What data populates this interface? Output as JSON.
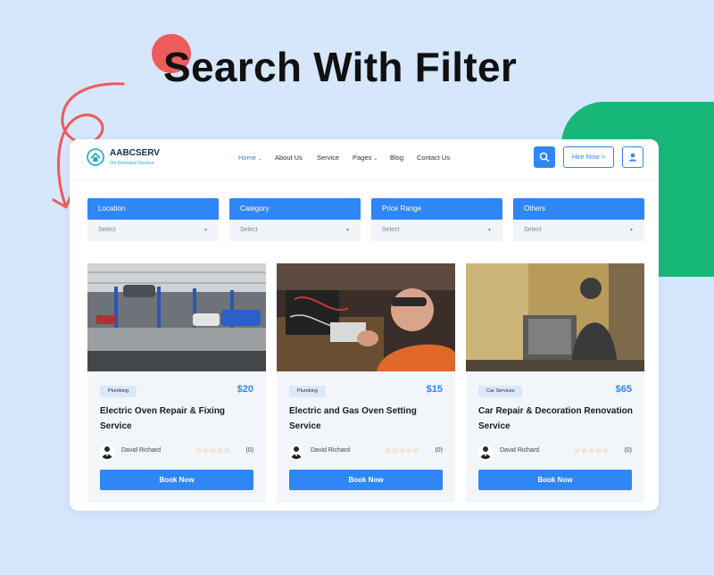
{
  "headline": "Search With Filter",
  "brand": {
    "name": "AABCSERV",
    "tagline": "On Demand Service"
  },
  "nav": {
    "items": [
      "Home",
      "About Us",
      "Service",
      "Pages",
      "Blog",
      "Contact Us"
    ],
    "active": "Home"
  },
  "actions": {
    "hire_label": "Hire Now >"
  },
  "filters": [
    {
      "label": "Location",
      "value": "Select"
    },
    {
      "label": "Category",
      "value": "Select"
    },
    {
      "label": "Price Range",
      "value": "Select"
    },
    {
      "label": "Others",
      "value": "Select"
    }
  ],
  "services": [
    {
      "category": "Plumbing",
      "price": "$20",
      "title": "Electric Oven Repair & Fixing Service",
      "author": "David Richard",
      "stars": "☆☆☆☆☆",
      "reviews": "(0)",
      "button": "Book Now",
      "image": "auto-repair-garage"
    },
    {
      "category": "Plumbing",
      "price": "$15",
      "title": "Electric and Gas Oven Setting Service",
      "author": "David Richard",
      "stars": "☆☆☆☆☆",
      "reviews": "(0)",
      "button": "Book Now",
      "image": "electronics-repair"
    },
    {
      "category": "Car Services",
      "price": "$65",
      "title": "Car Repair & Decoration Renovation Service",
      "author": "David Richard",
      "stars": "☆☆☆☆☆",
      "reviews": "(0)",
      "button": "Book Now",
      "image": "engine-mechanic"
    }
  ],
  "colors": {
    "accent": "#2f86f6",
    "green": "#18b77a",
    "red": "#ee5b5b",
    "background": "#d6e6fb"
  }
}
